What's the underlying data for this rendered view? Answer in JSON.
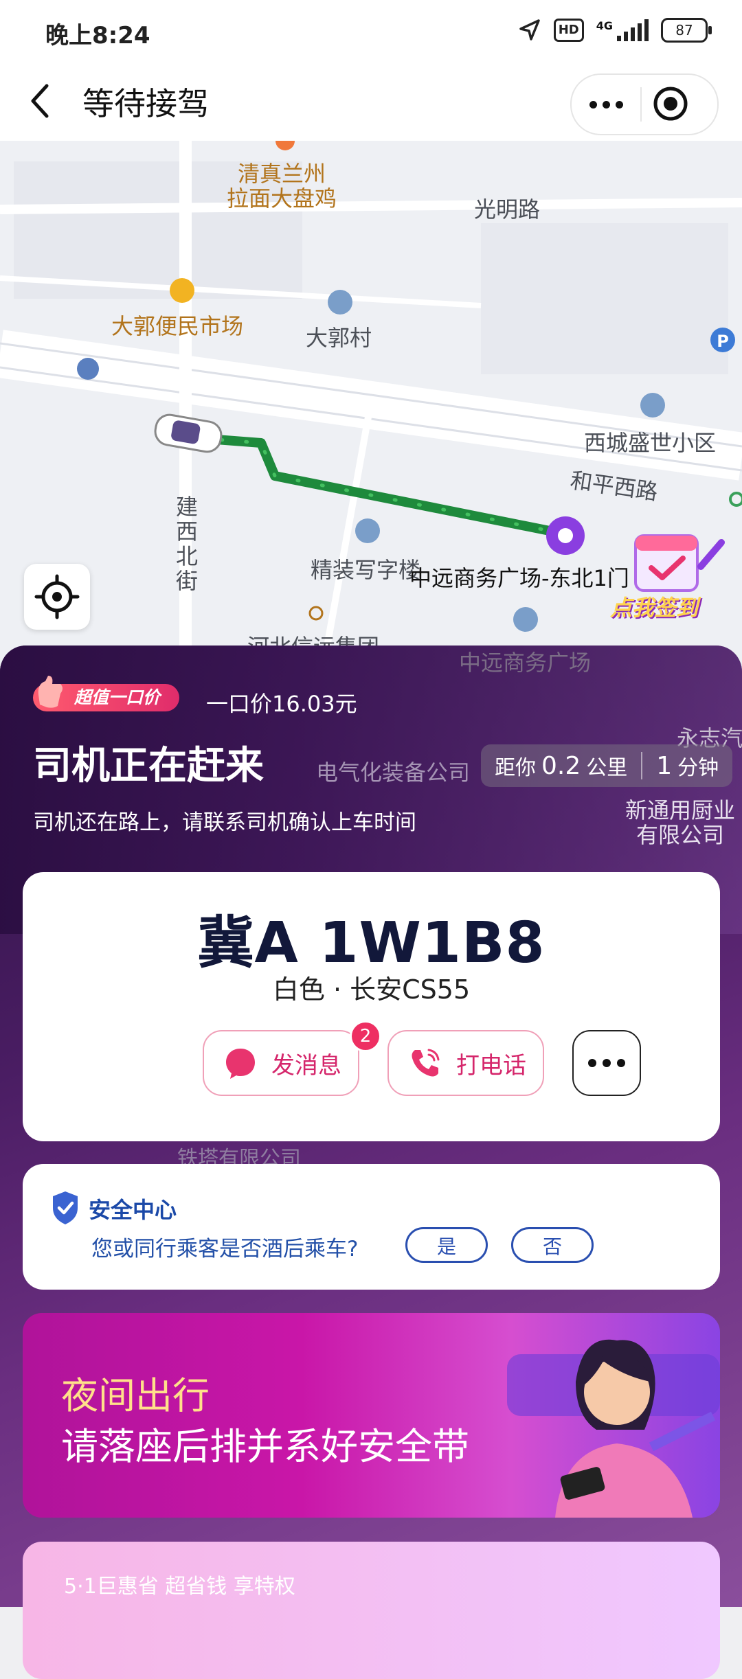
{
  "status_bar": {
    "time": "晚上8:24",
    "hd": "HD",
    "network": "4G",
    "battery": "87"
  },
  "nav": {
    "title": "等待接驾"
  },
  "map": {
    "labels": {
      "restaurant": "清真兰州\n拉面大盘鸡",
      "road1": "光明路",
      "market": "大郭便民市场",
      "village": "大郭村",
      "xicheng": "西城盛世小区",
      "heping": "和平西路",
      "jianxi": "建\n西\n北\n街",
      "office": "精装写字楼",
      "dest": "中远商务广场-东北1门",
      "hebei": "河北信远集团",
      "zhongyuan": "中远商务广场",
      "dianqi": "电气化装备公司",
      "yongzhi": "永志汽",
      "tongyong": "新通用厨业\n有限公司",
      "tieta": "铁塔有限公司"
    },
    "signin_label": "点我签到"
  },
  "panel": {
    "badge": "超值一口价",
    "price": "一口价16.03元",
    "heading": "司机正在赶来",
    "distance": {
      "prefix": "距你",
      "value": "0.2",
      "unit": "公里",
      "time_value": "1",
      "time_unit": "分钟"
    },
    "subtext": "司机还在路上，请联系司机确认上车时间"
  },
  "driver_card": {
    "plate": "冀A 1W1B8",
    "car": "白色 · 长安CS55",
    "message_label": "发消息",
    "message_count": "2",
    "call_label": "打电话"
  },
  "safety": {
    "title": "安全中心",
    "question": "您或同行乘客是否酒后乘车?",
    "yes": "是",
    "no": "否"
  },
  "banner": {
    "line1": "夜间出行",
    "line2": "请落座后排并系好安全带"
  },
  "promo": {
    "text": "5·1巨惠省 超省钱 享特权"
  },
  "colors": {
    "accent": "#d5266b",
    "route": "#1e8a3c",
    "panel": "#4a1d63",
    "safety": "#2a4fb0"
  }
}
